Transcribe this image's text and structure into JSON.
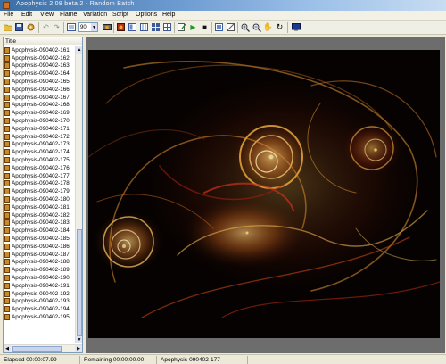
{
  "window": {
    "title": "Apophysis 2.08 beta 2 - Random Batch"
  },
  "menu": [
    "File",
    "Edit",
    "View",
    "Flame",
    "Variation",
    "Script",
    "Options",
    "Help"
  ],
  "toolbar": {
    "quality_value": "90",
    "icons": [
      "open-icon",
      "save-icon",
      "settings-icon",
      "undo-icon",
      "redo-icon",
      "batch-icon",
      "render-icon",
      "editor-icon",
      "adjust-icon",
      "gradient-icon",
      "mutate-icon",
      "options-icon",
      "script-run-icon",
      "play-icon",
      "stop-icon",
      "fullscreen-icon",
      "transparency-icon",
      "zoom-in-icon",
      "zoom-out-icon",
      "pan-hand-icon",
      "rotate-icon",
      "monitor-icon"
    ]
  },
  "list": {
    "header": "Title",
    "items": [
      "Apophysis-090402-161",
      "Apophysis-090402-162",
      "Apophysis-090402-163",
      "Apophysis-090402-164",
      "Apophysis-090402-165",
      "Apophysis-090402-166",
      "Apophysis-090402-167",
      "Apophysis-090402-168",
      "Apophysis-090402-169",
      "Apophysis-090402-170",
      "Apophysis-090402-171",
      "Apophysis-090402-172",
      "Apophysis-090402-173",
      "Apophysis-090402-174",
      "Apophysis-090402-175",
      "Apophysis-090402-176",
      "Apophysis-090402-177",
      "Apophysis-090402-178",
      "Apophysis-090402-179",
      "Apophysis-090402-180",
      "Apophysis-090402-181",
      "Apophysis-090402-182",
      "Apophysis-090402-183",
      "Apophysis-090402-184",
      "Apophysis-090402-185",
      "Apophysis-090402-186",
      "Apophysis-090402-187",
      "Apophysis-090402-188",
      "Apophysis-090402-189",
      "Apophysis-090402-190",
      "Apophysis-090402-191",
      "Apophysis-090402-192",
      "Apophysis-090402-193",
      "Apophysis-090402-194",
      "Apophysis-090402-195"
    ]
  },
  "status": {
    "elapsed": "Elapsed 00:00:07.99",
    "remaining": "Remaining 00:00:00.00",
    "current_flame": "Apophysis-090402-177"
  },
  "colors": {
    "titlebar": "#3a6ea5",
    "chrome": "#ece9d8",
    "render_bg": "#050201",
    "flame_orange": "#f0a030",
    "flame_red": "#c82818"
  }
}
